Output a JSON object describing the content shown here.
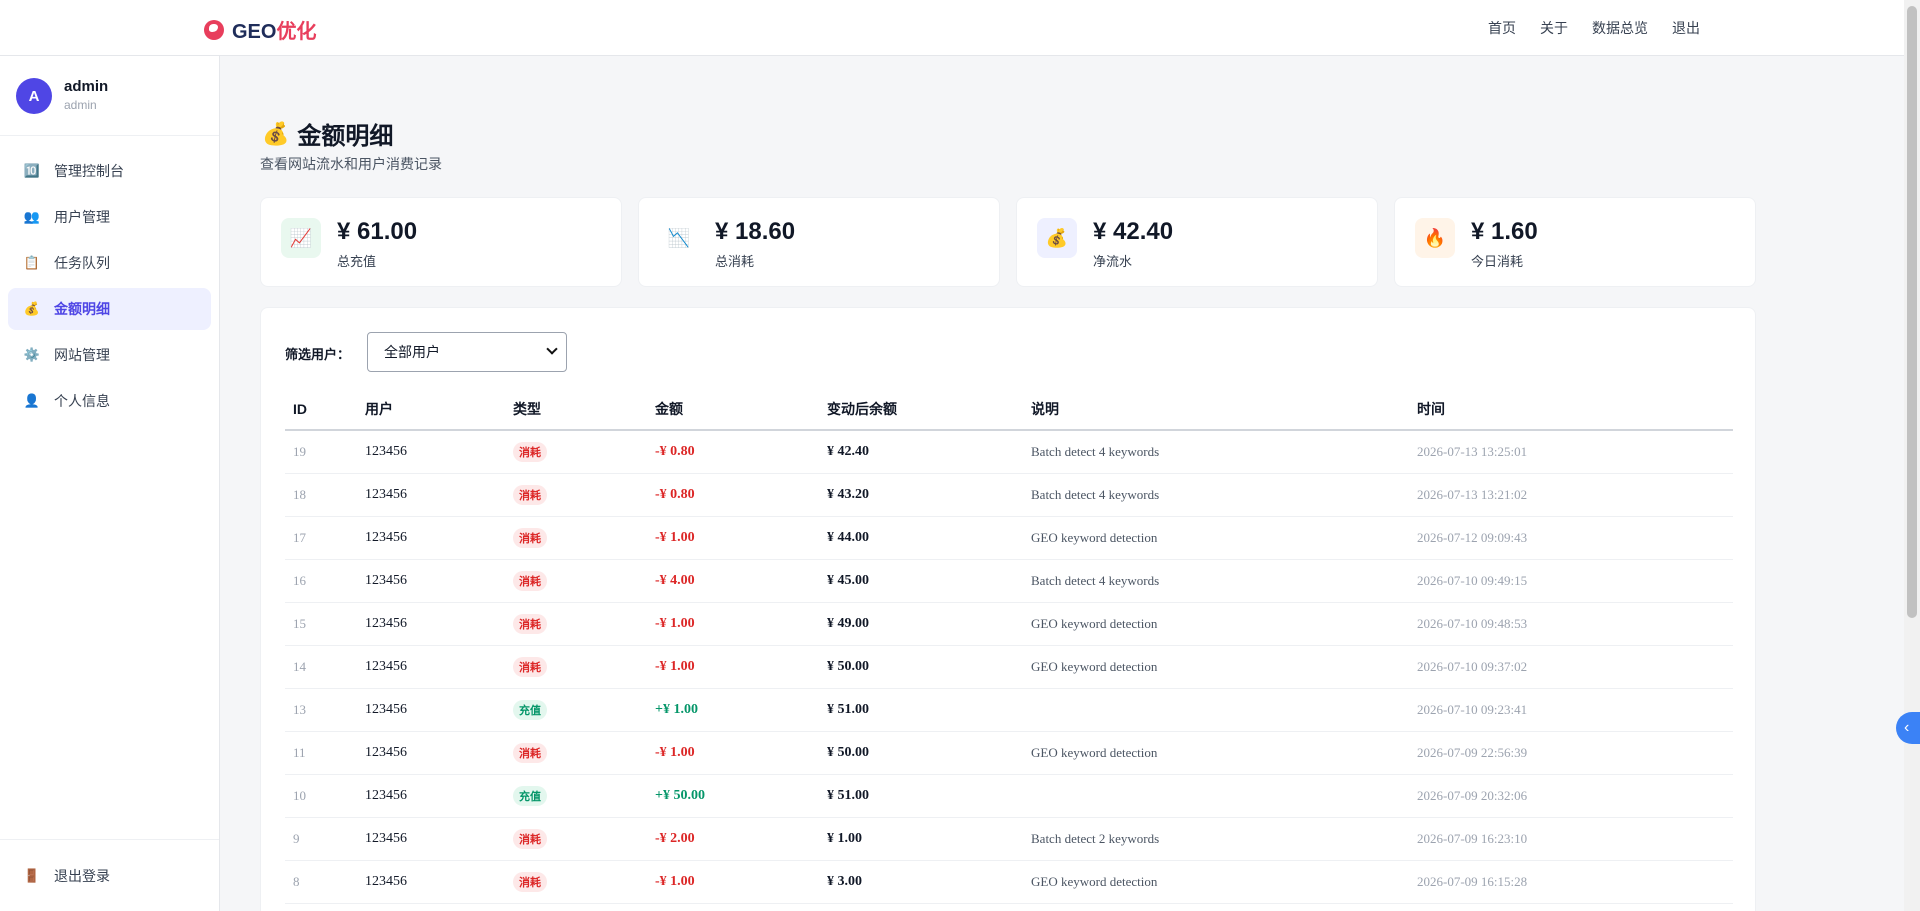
{
  "brand": {
    "text_main": "GEO",
    "text_accent": "优化"
  },
  "topnav": {
    "links": [
      "首页",
      "关于",
      "数据总览",
      "退出"
    ]
  },
  "user": {
    "initial": "A",
    "name": "admin",
    "role": "admin"
  },
  "sidebar": {
    "items": [
      {
        "label": "管理控制台",
        "icon": "dashboard-icon",
        "glyph": "🔟"
      },
      {
        "label": "用户管理",
        "icon": "users-icon",
        "glyph": "👥"
      },
      {
        "label": "任务队列",
        "icon": "clipboard-icon",
        "glyph": "📋"
      },
      {
        "label": "金额明细",
        "icon": "money-bag-icon",
        "glyph": "💰"
      },
      {
        "label": "网站管理",
        "icon": "gear-icon",
        "glyph": "⚙️"
      },
      {
        "label": "个人信息",
        "icon": "person-icon",
        "glyph": "👤"
      }
    ],
    "active_index": 3,
    "logout_label": "退出登录",
    "logout_glyph": "🚪"
  },
  "page": {
    "title": "金额明细",
    "title_glyph": "💰",
    "subtitle": "查看网站流水和用户消费记录"
  },
  "stats": [
    {
      "value": "¥ 61.00",
      "label": "总充值",
      "glyph": "📈",
      "icon": "chart-up-icon",
      "bg": "#e9f8ef"
    },
    {
      "value": "¥ 18.60",
      "label": "总消耗",
      "glyph": "📉",
      "icon": "chart-down-icon",
      "bg": "#ffffff"
    },
    {
      "value": "¥ 42.40",
      "label": "净流水",
      "glyph": "💰",
      "icon": "money-bag-icon",
      "bg": "#eef0ff"
    },
    {
      "value": "¥ 1.60",
      "label": "今日消耗",
      "glyph": "🔥",
      "icon": "fire-icon",
      "bg": "#fff4e8"
    }
  ],
  "filter": {
    "label": "筛选用户：",
    "selected": "全部用户"
  },
  "table": {
    "headers": [
      "ID",
      "用户",
      "类型",
      "金额",
      "变动后余额",
      "说明",
      "时间"
    ],
    "rows": [
      {
        "id": "19",
        "user": "123456",
        "type": "消耗",
        "amount": "-¥ 0.80",
        "balance": "¥ 42.40",
        "desc": "Batch detect 4 keywords",
        "time": "2026-07-13 13:25:01"
      },
      {
        "id": "18",
        "user": "123456",
        "type": "消耗",
        "amount": "-¥ 0.80",
        "balance": "¥ 43.20",
        "desc": "Batch detect 4 keywords",
        "time": "2026-07-13 13:21:02"
      },
      {
        "id": "17",
        "user": "123456",
        "type": "消耗",
        "amount": "-¥ 1.00",
        "balance": "¥ 44.00",
        "desc": "GEO keyword detection",
        "time": "2026-07-12 09:09:43"
      },
      {
        "id": "16",
        "user": "123456",
        "type": "消耗",
        "amount": "-¥ 4.00",
        "balance": "¥ 45.00",
        "desc": "Batch detect 4 keywords",
        "time": "2026-07-10 09:49:15"
      },
      {
        "id": "15",
        "user": "123456",
        "type": "消耗",
        "amount": "-¥ 1.00",
        "balance": "¥ 49.00",
        "desc": "GEO keyword detection",
        "time": "2026-07-10 09:48:53"
      },
      {
        "id": "14",
        "user": "123456",
        "type": "消耗",
        "amount": "-¥ 1.00",
        "balance": "¥ 50.00",
        "desc": "GEO keyword detection",
        "time": "2026-07-10 09:37:02"
      },
      {
        "id": "13",
        "user": "123456",
        "type": "充值",
        "amount": "+¥ 1.00",
        "balance": "¥ 51.00",
        "desc": "",
        "time": "2026-07-10 09:23:41"
      },
      {
        "id": "11",
        "user": "123456",
        "type": "消耗",
        "amount": "-¥ 1.00",
        "balance": "¥ 50.00",
        "desc": "GEO keyword detection",
        "time": "2026-07-09 22:56:39"
      },
      {
        "id": "10",
        "user": "123456",
        "type": "充值",
        "amount": "+¥ 50.00",
        "balance": "¥ 51.00",
        "desc": "",
        "time": "2026-07-09 20:32:06"
      },
      {
        "id": "9",
        "user": "123456",
        "type": "消耗",
        "amount": "-¥ 2.00",
        "balance": "¥ 1.00",
        "desc": "Batch detect 2 keywords",
        "time": "2026-07-09 16:23:10"
      },
      {
        "id": "8",
        "user": "123456",
        "type": "消耗",
        "amount": "-¥ 1.00",
        "balance": "¥ 3.00",
        "desc": "GEO keyword detection",
        "time": "2026-07-09 16:15:28"
      }
    ]
  },
  "side_tab": {
    "glyph": "‹"
  }
}
